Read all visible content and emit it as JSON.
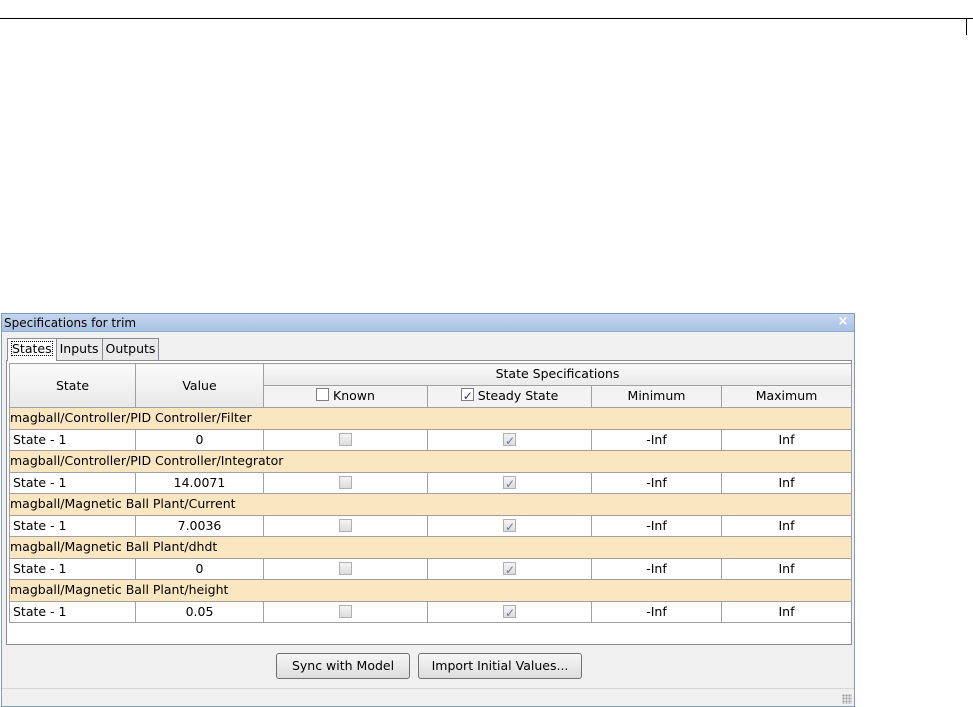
{
  "window": {
    "title": "Specifications for trim",
    "close_glyph": "×"
  },
  "tabs": [
    {
      "label": "States",
      "active": true
    },
    {
      "label": "Inputs",
      "active": false
    },
    {
      "label": "Outputs",
      "active": false
    }
  ],
  "table": {
    "headers": {
      "state": "State",
      "value": "Value",
      "group": "State Specifications",
      "known": "Known",
      "known_checked": false,
      "steady_state": "Steady State",
      "steady_state_checked": true,
      "minimum": "Minimum",
      "maximum": "Maximum"
    },
    "groups": [
      {
        "name": "magball/Controller/PID Controller/Filter",
        "rows": [
          {
            "state": "State - 1",
            "value": "0",
            "known": false,
            "steady": true,
            "min": "-Inf",
            "max": "Inf"
          }
        ]
      },
      {
        "name": "magball/Controller/PID Controller/Integrator",
        "rows": [
          {
            "state": "State - 1",
            "value": "14.0071",
            "known": false,
            "steady": true,
            "min": "-Inf",
            "max": "Inf"
          }
        ]
      },
      {
        "name": "magball/Magnetic Ball Plant/Current",
        "rows": [
          {
            "state": "State - 1",
            "value": "7.0036",
            "known": false,
            "steady": true,
            "min": "-Inf",
            "max": "Inf"
          }
        ]
      },
      {
        "name": "magball/Magnetic Ball Plant/dhdt",
        "rows": [
          {
            "state": "State - 1",
            "value": "0",
            "known": false,
            "steady": true,
            "min": "-Inf",
            "max": "Inf"
          }
        ]
      },
      {
        "name": "magball/Magnetic Ball Plant/height",
        "rows": [
          {
            "state": "State - 1",
            "value": "0.05",
            "known": false,
            "steady": true,
            "min": "-Inf",
            "max": "Inf"
          }
        ]
      }
    ]
  },
  "buttons": {
    "sync": "Sync with Model",
    "import": "Import Initial Values..."
  },
  "colors": {
    "group_row_bg": "#fbe6c2",
    "titlebar": "#b7cce9"
  }
}
